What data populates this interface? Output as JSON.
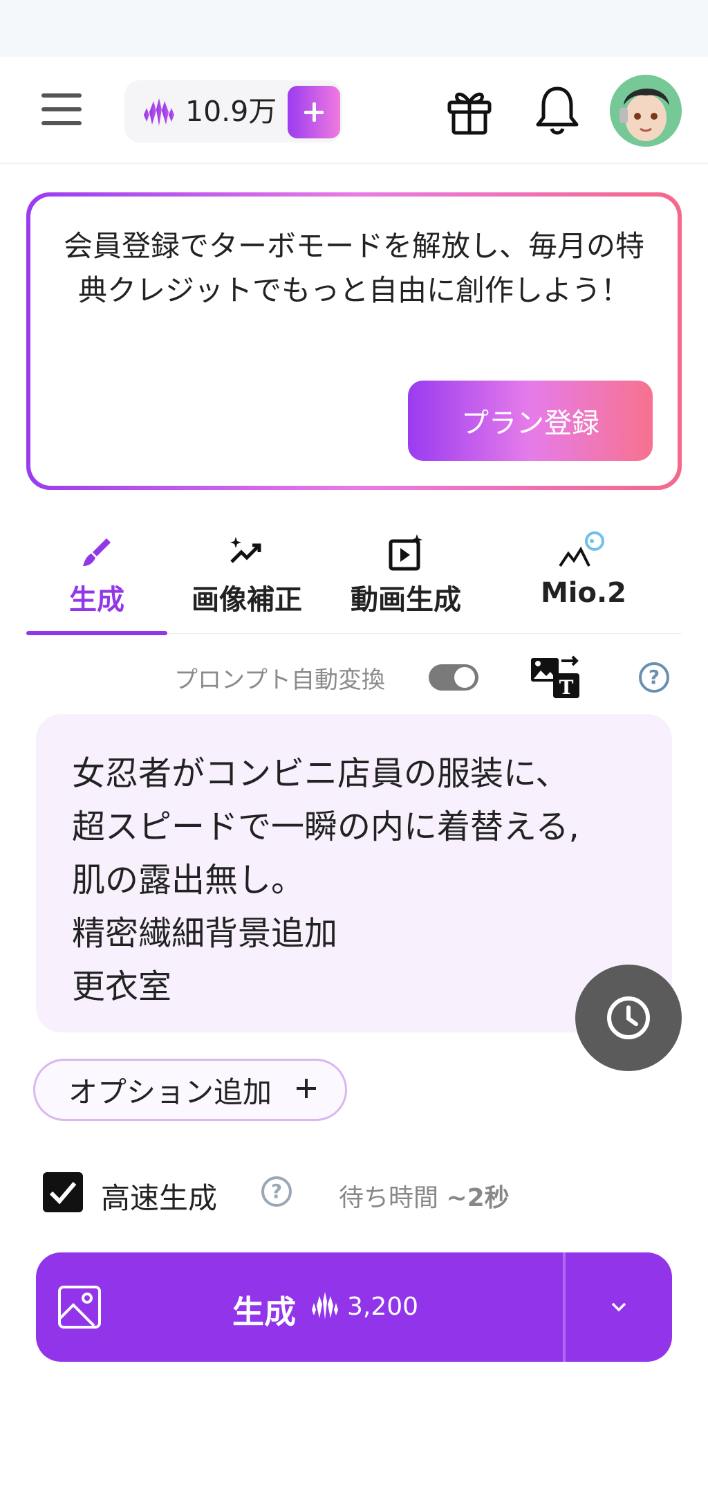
{
  "header": {
    "credits": "10.9万"
  },
  "promo": {
    "message": "会員登録でターボモードを解放し、毎月の特典クレジットでもっと自由に創作しよう！",
    "button_label": "プラン登録"
  },
  "tabs": [
    {
      "label": "生成",
      "active": true
    },
    {
      "label": "画像補正",
      "active": false
    },
    {
      "label": "動画生成",
      "active": false
    },
    {
      "label": "Mio.2",
      "active": false
    }
  ],
  "prompt_tools": {
    "auto_convert_label": "プロンプト自動変換",
    "auto_convert_on": true
  },
  "prompt": {
    "text": "女忍者がコンビニ店員の服装に、\n超スピードで一瞬の内に着替える,\n肌の露出無し。\n精密繊細背景追加\n更衣室"
  },
  "options": {
    "add_label": "オプション追加"
  },
  "fast_mode": {
    "label": "高速生成",
    "checked": true,
    "wait_prefix": "待ち時間 ",
    "wait_value": "~2秒"
  },
  "generate": {
    "label": "生成",
    "cost": "3,200"
  },
  "colors": {
    "accent": "#9234ea",
    "gradient_start": "#9a3bf0",
    "gradient_end": "#f5688a"
  }
}
